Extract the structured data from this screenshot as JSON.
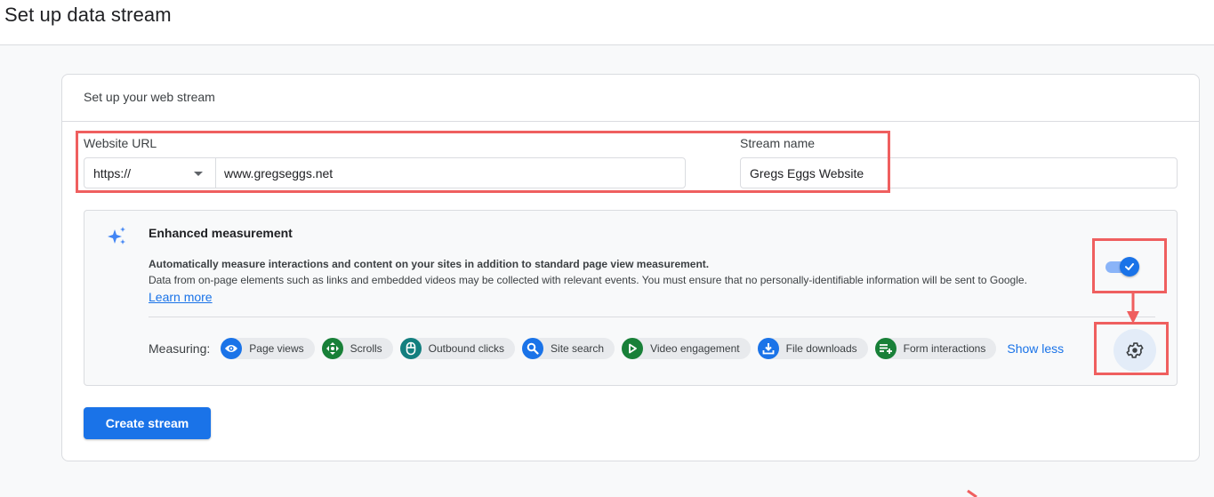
{
  "header": {
    "title": "Set up data stream"
  },
  "card": {
    "title": "Set up your web stream",
    "website_url": {
      "label": "Website URL",
      "protocol": "https://",
      "value": "www.gregseggs.net"
    },
    "stream_name": {
      "label": "Stream name",
      "value": "Gregs Eggs Website"
    },
    "enhanced_measurement": {
      "icon": "sparkle-icon",
      "title": "Enhanced measurement",
      "description_bold": "Automatically measure interactions and content on your sites in addition to standard page view measurement.",
      "description": "Data from on-page elements such as links and embedded videos may be collected with relevant events. You must ensure that no personally-identifiable information will be sent to Google.",
      "learn_more": "Learn more",
      "enabled": true,
      "measuring_label": "Measuring:",
      "chips": [
        {
          "label": "Page views",
          "icon": "eye-icon",
          "color": "#1a73e8"
        },
        {
          "label": "Scrolls",
          "icon": "scroll-arrows-icon",
          "color": "#188038"
        },
        {
          "label": "Outbound clicks",
          "icon": "mouse-icon",
          "color": "#137f7f"
        },
        {
          "label": "Site search",
          "icon": "search-icon",
          "color": "#1a73e8"
        },
        {
          "label": "Video engagement",
          "icon": "play-icon",
          "color": "#188038"
        },
        {
          "label": "File downloads",
          "icon": "download-icon",
          "color": "#1a73e8"
        },
        {
          "label": "Form interactions",
          "icon": "form-add-icon",
          "color": "#188038"
        }
      ],
      "show_less": "Show less",
      "settings_icon": "gear-icon"
    },
    "create_button": "Create stream"
  },
  "annotation_color": "#ef5f5f"
}
